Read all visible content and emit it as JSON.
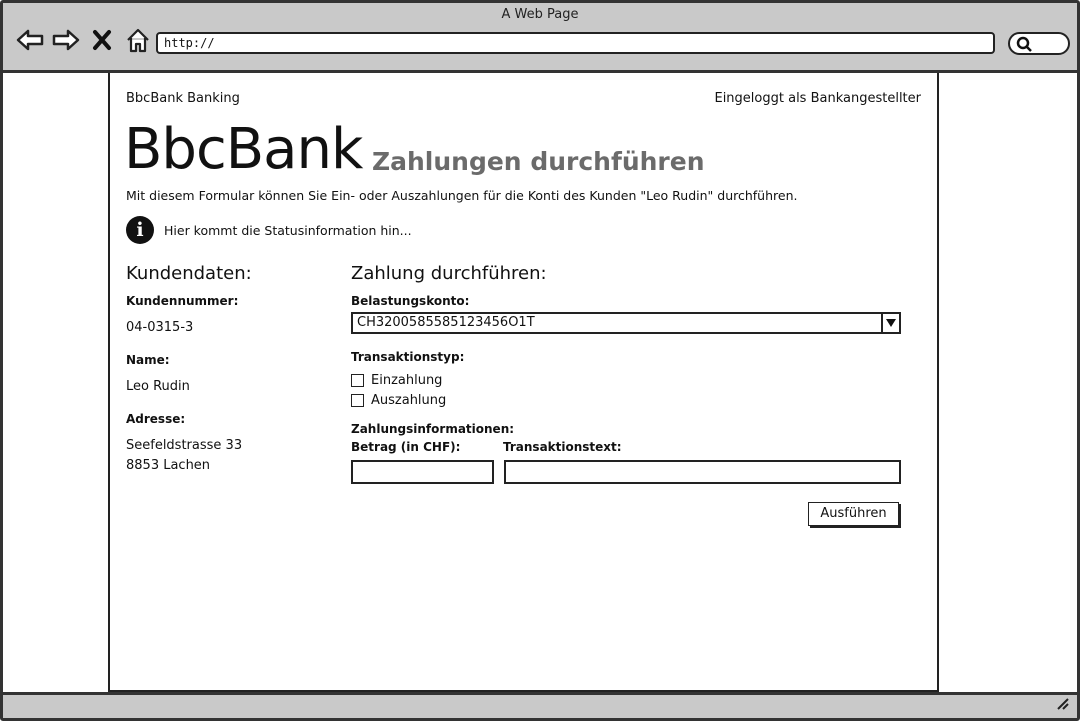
{
  "browser": {
    "window_title": "A Web Page",
    "url": "http://"
  },
  "page": {
    "app_name": "BbcBank Banking",
    "login_status": "Eingeloggt als Bankangestellter",
    "brand": "BbcBank",
    "subtitle": "Zahlungen durchführen",
    "intro": "Mit diesem Formular können Sie Ein- oder Auszahlungen für die Konti des Kunden \"Leo Rudin\" durchführen.",
    "status_text": "Hier kommt die Statusinformation hin..."
  },
  "customer": {
    "heading": "Kundendaten:",
    "number_label": "Kundennummer:",
    "number": "04-0315-3",
    "name_label": "Name:",
    "name": "Leo Rudin",
    "address_label": "Adresse:",
    "street": "Seefeldstrasse 33",
    "city": "8853 Lachen"
  },
  "payment": {
    "heading": "Zahlung durchführen:",
    "account_label": "Belastungskonto:",
    "account_selected": "CH3200585585123456O1T",
    "type_label": "Transaktionstyp:",
    "type_options": [
      "Einzahlung",
      "Auszahlung"
    ],
    "info_label": "Zahlungsinformationen:",
    "amount_label": "Betrag (in CHF):",
    "text_label": "Transaktionstext:",
    "submit_label": "Ausführen"
  }
}
